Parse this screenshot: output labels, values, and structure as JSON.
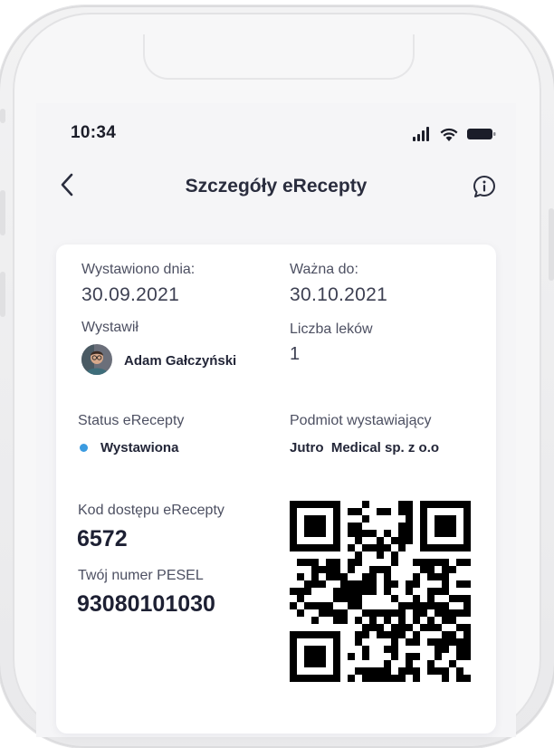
{
  "status_bar": {
    "time": "10:34"
  },
  "nav": {
    "title": "Szczegóły eRecepty"
  },
  "prescription": {
    "issued_label": "Wystawiono dnia:",
    "issued_date": "30.09.2021",
    "valid_label": "Ważna do:",
    "valid_date": "30.10.2021",
    "issuer_label": "Wystawił",
    "issuer_name": "Adam Gałczyński",
    "drugs_count_label": "Liczba leków",
    "drugs_count": "1",
    "status_label": "Status eRecepty",
    "status_value": "Wystawiona",
    "entity_label": "Podmiot wystawiający",
    "entity_value": "Jutro  Medical sp. z o.o",
    "access_code_label": "Kod dostępu eRecepty",
    "access_code": "6572",
    "pesel_label": "Twój numer PESEL",
    "pesel": "93080101030"
  },
  "colors": {
    "status_dot": "#3b9be0",
    "text_dark": "#1d2033",
    "background": "#f5f5f7"
  },
  "icons": [
    "signal-icon",
    "wifi-icon",
    "battery-icon",
    "back-chevron-icon",
    "info-icon",
    "avatar"
  ]
}
